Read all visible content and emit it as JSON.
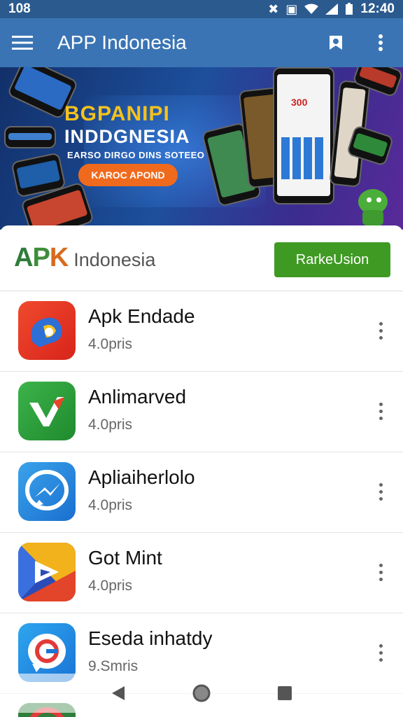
{
  "status_bar": {
    "left_text": "108",
    "time": "12:40"
  },
  "app_bar": {
    "title": "APP Indonesia"
  },
  "banner": {
    "headline1": "BGPANIPI",
    "headline2": "INDDGNESIA",
    "subtitle": "EARSO DIRGO DINS SOTEEO",
    "cta_label": "KAROC APOND",
    "phone_screen_text": "300"
  },
  "brand": {
    "logo_text": "APK",
    "wordmark": "Indonesia",
    "button_label": "RarkeUsion"
  },
  "apps": [
    {
      "name": "Apk Endade",
      "meta": "4.0pris",
      "icon": "blue-chat-icon"
    },
    {
      "name": "Anlimarved",
      "meta": "4.0pris",
      "icon": "green-check-icon"
    },
    {
      "name": "Apliaiherlolo",
      "meta": "4.0pris",
      "icon": "messenger-icon"
    },
    {
      "name": "Got Mint",
      "meta": "4.0pris",
      "icon": "play-triangle-icon"
    },
    {
      "name": "Eseda inhatdy",
      "meta": "9.Smris",
      "icon": "g-chat-icon"
    }
  ],
  "nav": {
    "back": "back-icon",
    "home": "home-icon",
    "recents": "recents-icon"
  },
  "colors": {
    "app_bar": "#3a74b4",
    "status_bar": "#2a5a8e",
    "green_button": "#3f9a23",
    "banner_accent": "#f06a1d"
  }
}
